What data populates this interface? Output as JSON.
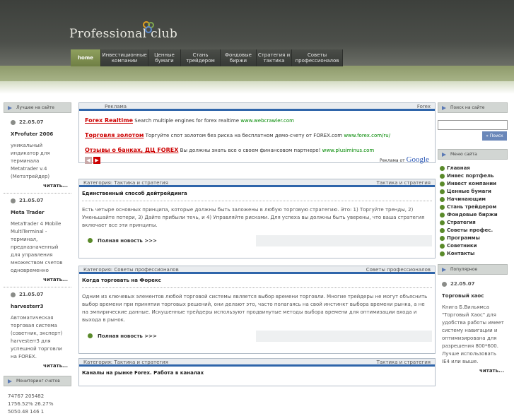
{
  "site": {
    "logo": "Professional club"
  },
  "nav": [
    {
      "label": "home",
      "active": true
    },
    {
      "label": "Инвестиционные компании"
    },
    {
      "label": "Ценные бумаги"
    },
    {
      "label": "Стань трейдером"
    },
    {
      "label": "Фондовые биржи"
    },
    {
      "label": "Стратегия и тактика"
    },
    {
      "label": "Советы профессионалов"
    }
  ],
  "left": {
    "best_title": "Лучшее на сайте",
    "items": [
      {
        "date": "22.05.07",
        "title": "XProfuter 2006",
        "text": "уникальный индикатор для терминала Metatrader v.4 (Метатрейдер)",
        "more": "читать..."
      },
      {
        "date": "21.05.07",
        "title": "Meta Trader",
        "text": "MetaTrader 4 Mobile MultiTerminal - терминал, предназначенный для управления множеством счетов одновременно",
        "more": "читать..."
      },
      {
        "date": "21.05.07",
        "title": "harvesterr3",
        "text": "Автоматическая торговая система (советник, эксперт) harvesterr3 для успешной торговли на FOREX.",
        "more": "читать..."
      }
    ],
    "monitor_title": "Мониторинг счетов",
    "monitor_text": "74767 205482 1756.52% 26.27% 5050.48 146 1"
  },
  "ads": {
    "left_label": "Реклама",
    "right_label": "Forex",
    "items": [
      {
        "title": "Forex Realtime",
        "text": "Search multiple engines for forex realtime",
        "url": "www.webcrawler.com"
      },
      {
        "title": "Торговля золотом",
        "text": "Торгуйте спот золотом без риска на бесплатном демо-счету от FOREX.com",
        "url": "www.forex.com/ru/"
      },
      {
        "title": "Отзывы о банках, ДЦ FOREX",
        "text": "Вы должны знать все о своем финансовом партнере!",
        "url": "www.plusiminus.com"
      }
    ],
    "google": "Реклама от",
    "google_brand": "Google"
  },
  "articles": [
    {
      "category": "Категория: Тактика и стратегия",
      "cat_right": "Тактика и стратегия",
      "title": "Единственный способ дейтрейдинга",
      "text": "Есть четыре основных принципа, которые должны быть заложены в любую торговую стратегию. Это: 1) Торгуйте тренды, 2) Уменьшайте потери, 3) Дайте прибыли течь, и 4) Управляйте рисками. Для успеха вы должны быть уверены, что ваша стратегия включает все эти принципы.",
      "more": "Полная новость >>>"
    },
    {
      "category": "Категория: Советы профессионалов",
      "cat_right": "Советы профессионалов",
      "title": "Когда торговать на Форекс",
      "text": "Одним из ключевых элементов любой торговой системы является выбор времени торговли. Многие трейдеры не могут объяснить выбор времени при принятии торговых решений, они делают это, часто полагаясь на свой инстинкт выбора времени рынка, а не на эмпирические данные. Искушенные трейдеры используют продвинутые методы выбора времени для оптимизации входа и выхода в рынок.",
      "more": "Полная новость >>>"
    },
    {
      "category": "Категория: Тактика и стратегия",
      "cat_right": "Тактика и стратегия",
      "title": "Каналы на рынке Forex. Работа в каналах",
      "text": "",
      "more": ""
    }
  ],
  "right": {
    "search_title": "Поиск на сайте",
    "search_button": "» Поиск",
    "menu_title": "Меню сайта",
    "menu": [
      "Главная",
      "Инвес портфель",
      "Инвест компании",
      "Ценные бумаги",
      "Начинающим",
      "Стань трейдером",
      "Фондовые биржи",
      "Стратегия",
      "Советы профес.",
      "Программы",
      "Советники",
      "Контакты"
    ],
    "popular_title": "Популярное",
    "popular": {
      "date": "22.05.07",
      "title": "Торговый хаос",
      "text": "Книга Б.Вильямса \"Торговый Хаос\" для удобства работы имеет систему навигации и оптимизирована для разрешения 800*600. Лучше использовать IE4 или выше.",
      "more": "читать..."
    }
  },
  "colors": {
    "accent": "#2f65aa",
    "green": "#8fa05e",
    "ad_title": "#cc0000"
  }
}
